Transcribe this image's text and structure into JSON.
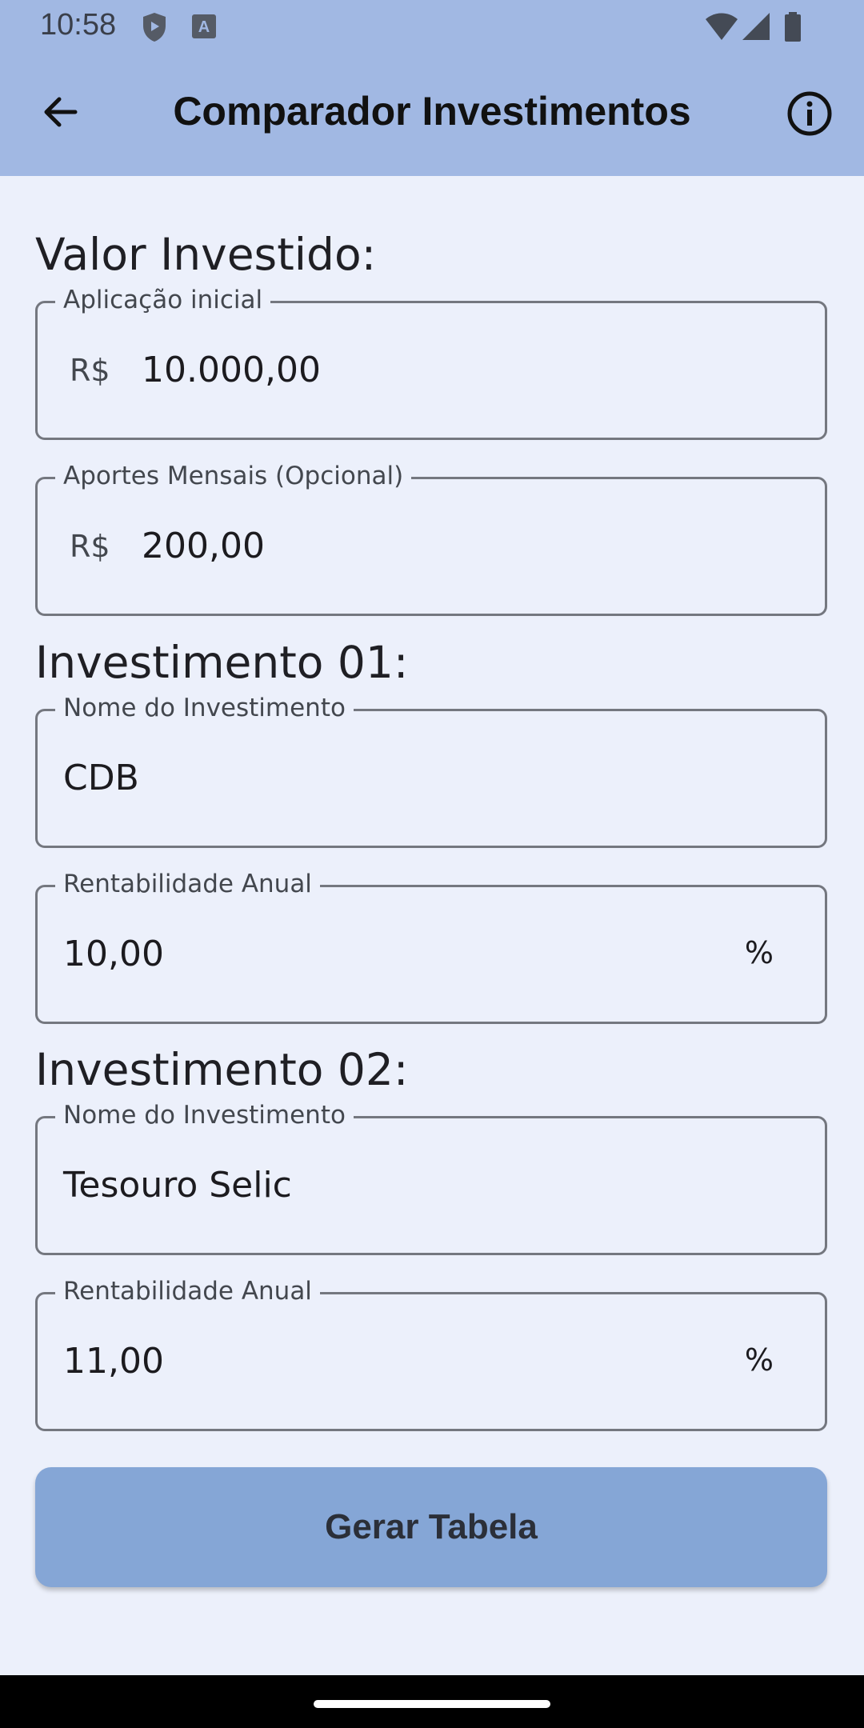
{
  "status_bar": {
    "time": "10:58",
    "icons": [
      "shield-play-icon",
      "text-a-icon",
      "wifi-icon",
      "signal-icon",
      "battery-icon"
    ]
  },
  "app_bar": {
    "title": "Comparador Investimentos",
    "back_icon": "arrow-left-icon",
    "info_icon": "info-icon"
  },
  "valor_investido": {
    "title": "Valor Investido:",
    "aplicacao_inicial": {
      "label": "Aplicação inicial",
      "prefix": "R$",
      "value": "10.000,00"
    },
    "aportes_mensais": {
      "label": "Aportes Mensais (Opcional)",
      "prefix": "R$",
      "value": "200,00"
    }
  },
  "investimento_01": {
    "title": "Investimento 01:",
    "nome": {
      "label": "Nome do Investimento",
      "value": "CDB"
    },
    "rentabilidade": {
      "label": "Rentabilidade Anual",
      "value": "10,00",
      "suffix": "%"
    }
  },
  "investimento_02": {
    "title": "Investimento 02:",
    "nome": {
      "label": "Nome do Investimento",
      "value": "Tesouro Selic"
    },
    "rentabilidade": {
      "label": "Rentabilidade Anual",
      "value": "11,00",
      "suffix": "%"
    }
  },
  "action": {
    "label": "Gerar Tabela"
  },
  "colors": {
    "app_bar": "#a1b8e3",
    "background": "#ecf0fb",
    "button": "#85a6d6",
    "outline": "#74777f"
  }
}
